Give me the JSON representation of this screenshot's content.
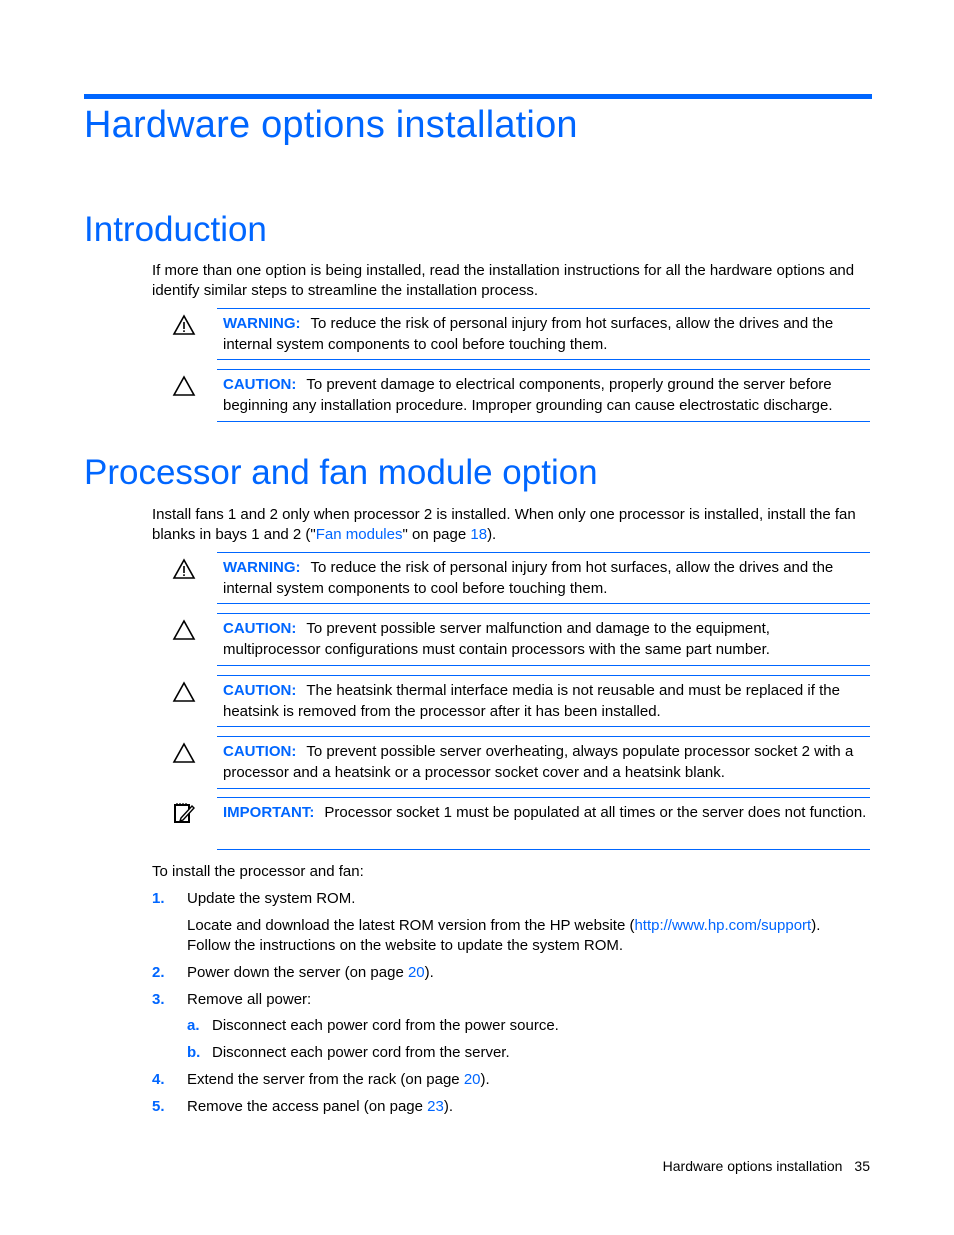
{
  "chapter_title": "Hardware options installation",
  "sections": {
    "intro": {
      "title": "Introduction",
      "paragraph": "If more than one option is being installed, read the installation instructions for all the hardware options and identify similar steps to streamline the installation process.",
      "notices": [
        {
          "type": "WARNING:",
          "icon": "warning-triangle-icon",
          "text": "To reduce the risk of personal injury from hot surfaces, allow the drives and the internal system components to cool before touching them."
        },
        {
          "type": "CAUTION:",
          "icon": "caution-triangle-icon",
          "text": "To prevent damage to electrical components, properly ground the server before beginning any installation procedure. Improper grounding can cause electrostatic discharge."
        }
      ]
    },
    "processor": {
      "title": "Processor and fan module option",
      "paragraph_pre": "Install fans 1 and 2 only when processor 2 is installed. When only one processor is installed, install the fan blanks in bays 1 and 2 (\"",
      "paragraph_link": "Fan modules",
      "paragraph_mid": "\" on page ",
      "paragraph_page": "18",
      "paragraph_post": ").",
      "notices": [
        {
          "type": "WARNING:",
          "icon": "warning-triangle-icon",
          "text": "To reduce the risk of personal injury from hot surfaces, allow the drives and the internal system components to cool before touching them."
        },
        {
          "type": "CAUTION:",
          "icon": "caution-triangle-icon",
          "text": "To prevent possible server malfunction and damage to the equipment, multiprocessor configurations must contain processors with the same part number."
        },
        {
          "type": "CAUTION:",
          "icon": "caution-triangle-icon",
          "text": "The heatsink thermal interface media is not reusable and must be replaced if the heatsink is removed from the processor after it has been installed."
        },
        {
          "type": "CAUTION:",
          "icon": "caution-triangle-icon",
          "text": "To prevent possible server overheating, always populate processor socket 2 with a processor and a heatsink or a processor socket cover and a heatsink blank."
        },
        {
          "type": "IMPORTANT:",
          "icon": "important-notepad-icon",
          "text": "Processor socket 1 must be populated at all times or the server does not function."
        }
      ],
      "procedure_intro": "To install the processor and fan:",
      "steps": [
        {
          "num": "1.",
          "text": "Update the system ROM."
        },
        {
          "num": "2.",
          "text": "Power down the server (on page ",
          "page": "20",
          "post": ")."
        },
        {
          "num": "3.",
          "text": "Remove all power:"
        },
        {
          "num": "4.",
          "text": "Extend the server from the rack (on page ",
          "page": "20",
          "post": ")."
        },
        {
          "num": "5.",
          "text": "Remove the access panel (on page ",
          "page": "23",
          "post": ")."
        }
      ],
      "step1_detail_pre": "Locate and download the latest ROM version from the HP website (",
      "step1_detail_link": "http://www.hp.com/support",
      "step1_detail_post": ").",
      "step1_detail_line2": "Follow the instructions on the website to update the system ROM.",
      "substeps": [
        {
          "num": "a.",
          "text": "Disconnect each power cord from the power source."
        },
        {
          "num": "b.",
          "text": "Disconnect each power cord from the server."
        }
      ]
    }
  },
  "footer": {
    "section": "Hardware options installation",
    "page": "35"
  }
}
